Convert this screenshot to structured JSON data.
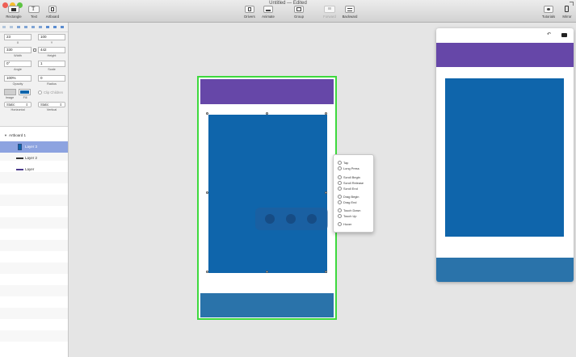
{
  "window": {
    "title": "Untitled — Edited"
  },
  "toolbar": {
    "left": [
      {
        "label": "Rectangle",
        "icon": "rectangle-icon"
      },
      {
        "label": "Text",
        "icon": "text-icon"
      },
      {
        "label": "Artboard",
        "icon": "artboard-icon"
      }
    ],
    "center": [
      {
        "label": "Drivers",
        "icon": "drivers-icon"
      },
      {
        "label": "Animate",
        "icon": "animate-icon"
      },
      {
        "label": "Group",
        "icon": "group-icon"
      },
      {
        "label": "Forward",
        "icon": "forward-icon",
        "disabled": true
      },
      {
        "label": "Backward",
        "icon": "backward-icon"
      }
    ],
    "right": [
      {
        "label": "Tutorials",
        "icon": "tutorials-icon"
      },
      {
        "label": "Mirror",
        "icon": "mirror-icon"
      }
    ]
  },
  "inspector": {
    "x": {
      "value": "23",
      "label": "X"
    },
    "y": {
      "value": "100",
      "label": "Y"
    },
    "width": {
      "value": "330",
      "label": "Width"
    },
    "height": {
      "value": "442",
      "label": "Height"
    },
    "angle": {
      "value": "0°",
      "label": "Angle"
    },
    "scale": {
      "value": "1",
      "label": "Scale"
    },
    "opacity": {
      "value": "100%",
      "label": "Opacity"
    },
    "radius": {
      "value": "0",
      "label": "Radius"
    },
    "image_label": "Image",
    "fill_label": "Fill",
    "clip_children": "Clip Children",
    "horizontal": {
      "value": "Static",
      "label": "Horizontal"
    },
    "vertical": {
      "value": "Static",
      "label": "Vertical"
    }
  },
  "layers": {
    "artboard": "Artboard 1",
    "items": [
      {
        "name": "Layer 3",
        "selected": true
      },
      {
        "name": "Layer 2",
        "selected": false
      },
      {
        "name": "Layer",
        "selected": false
      }
    ]
  },
  "triggers": [
    "Tap",
    "Long Press",
    "Scroll Begin",
    "Scroll Release",
    "Scroll End",
    "Drag Begin",
    "Drag End",
    "Touch Down",
    "Touch Up",
    "Hover"
  ],
  "colors": {
    "selection": "#3dd93d",
    "purple": "#6647a8",
    "blue": "#0f65ab",
    "steel_blue": "#2a73aa",
    "layer_highlight": "#8da3e0"
  }
}
